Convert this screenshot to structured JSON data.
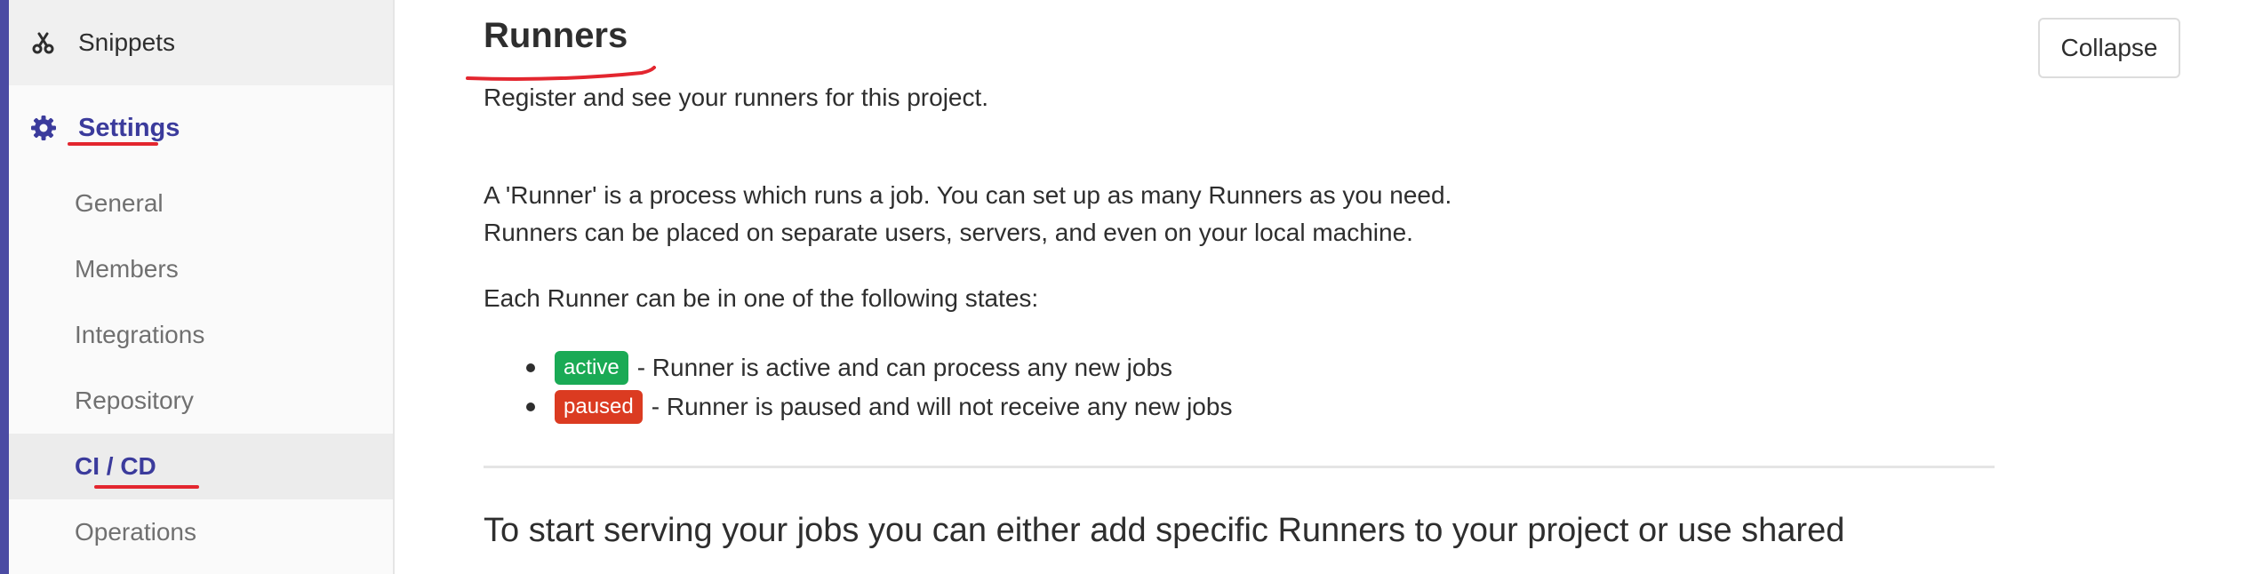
{
  "sidebar": {
    "snippets_label": "Snippets",
    "settings_label": "Settings",
    "sub_items": [
      {
        "label": "General"
      },
      {
        "label": "Members"
      },
      {
        "label": "Integrations"
      },
      {
        "label": "Repository"
      },
      {
        "label": "CI / CD",
        "active": true
      },
      {
        "label": "Operations"
      }
    ]
  },
  "main": {
    "title": "Runners",
    "collapse_label": "Collapse",
    "subtitle": "Register and see your runners for this project.",
    "description_line1": "A 'Runner' is a process which runs a job. You can set up as many Runners as you need.",
    "description_line2": "Runners can be placed on separate users, servers, and even on your local machine.",
    "states_intro": "Each Runner can be in one of the following states:",
    "states": [
      {
        "badge": "active",
        "text": "- Runner is active and can process any new jobs"
      },
      {
        "badge": "paused",
        "text": "- Runner is paused and will not receive any new jobs"
      }
    ],
    "bottom_text": "To start serving your jobs you can either add specific Runners to your project or use shared"
  },
  "colors": {
    "accent": "#3b3b9c",
    "badge_active": "#1aaa55",
    "badge_paused": "#db3b21",
    "annotation": "#e3262f"
  },
  "icons": {
    "snippets": "scissors-icon",
    "settings": "gear-icon"
  }
}
